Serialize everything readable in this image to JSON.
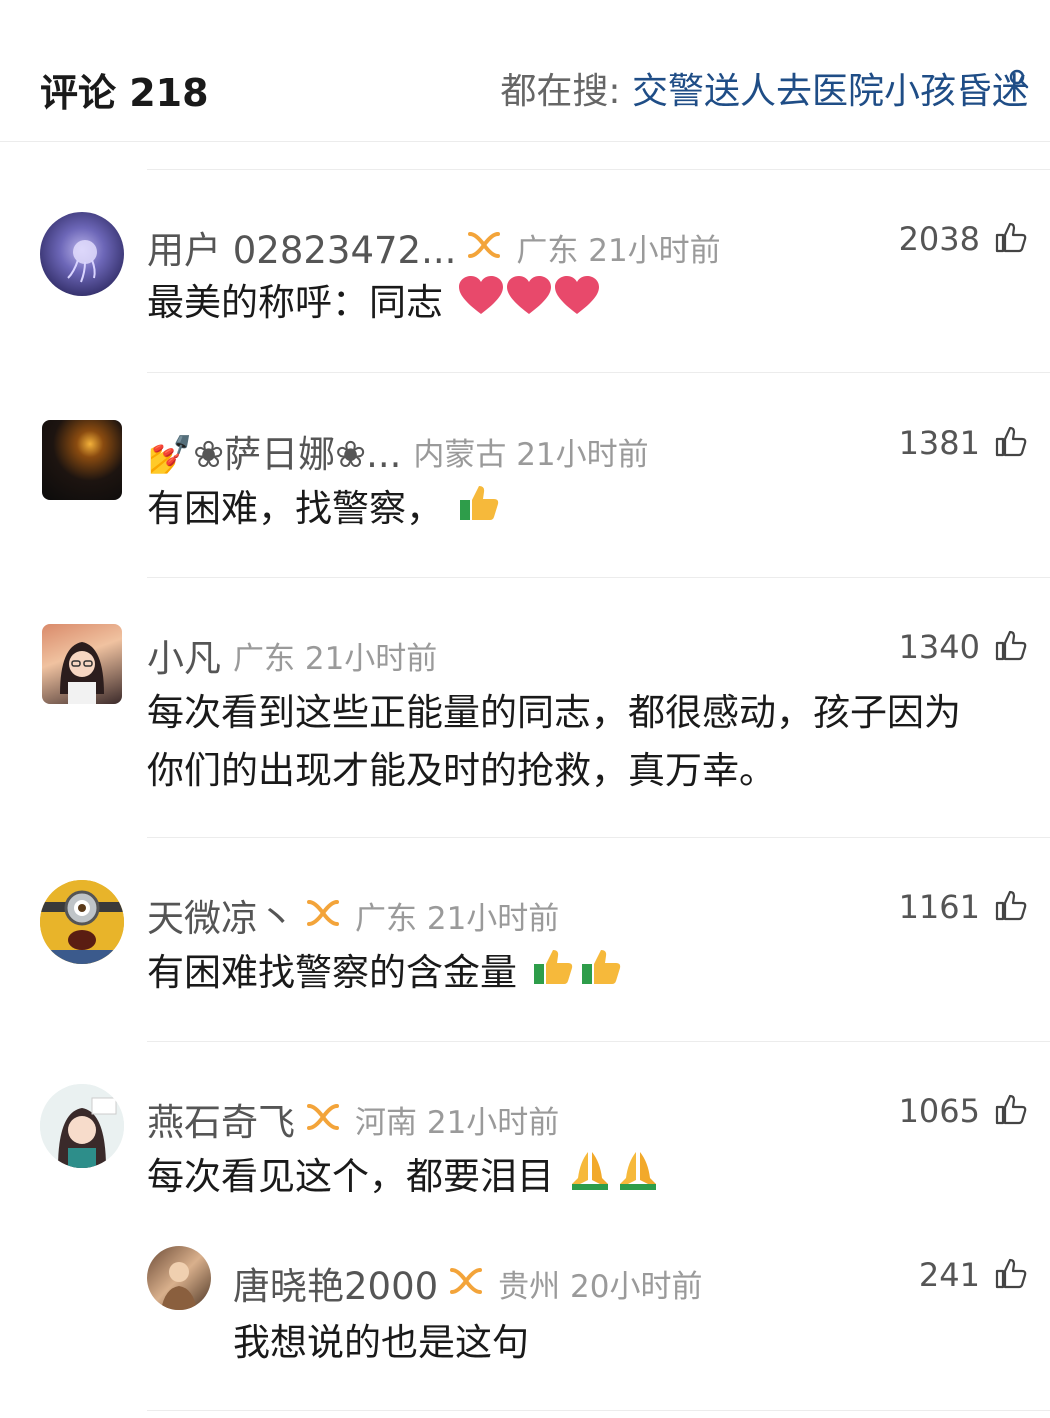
{
  "header": {
    "title": "评论 218",
    "search_label": "都在搜: ",
    "search_query": "交警送人去医院小孩昏迷"
  },
  "comments": [
    {
      "name": "用户 02823472...",
      "region": "广东 21小时前",
      "likes": "2038",
      "text": "最美的称呼：同志",
      "emoji": "heart x3",
      "badge": "infinity-badge-icon"
    },
    {
      "name": "💅❀萨日娜❀...",
      "region": "内蒙古 21小时前",
      "likes": "1381",
      "text": "有困难，找警察，",
      "emoji": "thumbs-up x1"
    },
    {
      "name": "小凡",
      "region": "广东 21小时前",
      "likes": "1340",
      "text_line1": "每次看到这些正能量的同志，都很感动，孩子因为",
      "text_line2": "你们的出现才能及时的抢救，真万幸。"
    },
    {
      "name": "天微凉丶",
      "region": "广东 21小时前",
      "likes": "1161",
      "text": "有困难找警察的含金量",
      "emoji": "thumbs-up x2",
      "badge": "infinity-badge-icon"
    },
    {
      "name": "燕石奇飞",
      "region": "河南 21小时前",
      "likes": "1065",
      "text": "每次看见这个，都要泪目",
      "emoji": "folded-hands x2",
      "badge": "infinity-badge-icon"
    }
  ],
  "reply": {
    "name": "唐晓艳2000",
    "region": "贵州 20小时前",
    "likes": "241",
    "text": "我想说的也是这句",
    "badge": "infinity-badge-icon"
  },
  "colors": {
    "link_blue": "#1f4d86",
    "badge_orange": "#f3a43a",
    "heart_pink": "#e8496b"
  }
}
